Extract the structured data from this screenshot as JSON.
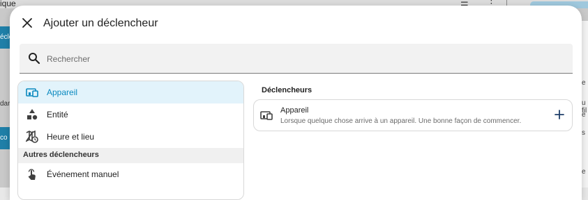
{
  "background": {
    "top_title_fragment": "ique",
    "left_buttons": [
      {
        "text": "éclé"
      },
      {
        "text": "co"
      }
    ],
    "left_texts": [
      {
        "text": "dar"
      }
    ],
    "right_texts": [
      {
        "text": "e"
      },
      {
        "text": "u fil"
      },
      {
        "text": "e"
      },
      {
        "text": "s"
      },
      {
        "text": "e"
      }
    ]
  },
  "dialog": {
    "title": "Ajouter un déclencheur",
    "search": {
      "placeholder": "Rechercher",
      "value": ""
    },
    "list": {
      "items": [
        {
          "label": "Appareil",
          "icon": "device-icon",
          "selected": true
        },
        {
          "label": "Entité",
          "icon": "shapes-icon",
          "selected": false
        },
        {
          "label": "Heure et lieu",
          "icon": "map-clock-icon",
          "selected": false
        }
      ],
      "section_header": "Autres déclencheurs",
      "other_items": [
        {
          "label": "Événement manuel",
          "icon": "gesture-tap-icon"
        }
      ]
    },
    "right": {
      "title": "Déclencheurs",
      "card": {
        "name": "Appareil",
        "description": "Lorsque quelque chose arrive à un appareil. Une bonne façon de commencer.",
        "icon": "device-icon",
        "action_icon": "plus-icon"
      }
    }
  },
  "colors": {
    "accent": "#0a89bf",
    "selected_bg": "#e2f3fb",
    "icon": "#3f3f3f"
  }
}
